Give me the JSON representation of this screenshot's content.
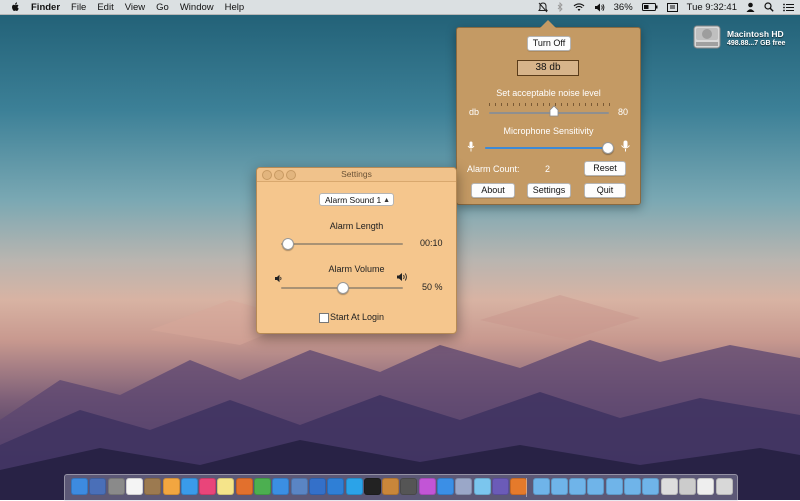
{
  "menubar": {
    "apple_icon": "apple-icon",
    "items": [
      "Finder",
      "File",
      "Edit",
      "View",
      "Go",
      "Window",
      "Help"
    ],
    "battery": "36%",
    "clock": "Tue 9:32:41"
  },
  "desktop": {
    "drive_name": "Macintosh HD",
    "drive_size": "498.88...7 GB free"
  },
  "popover": {
    "toggle_label": "Turn Off",
    "level_display": "38 db",
    "noise_label": "Set acceptable noise level",
    "noise_unit": "db",
    "noise_value": "80",
    "noise_fraction": 0.5,
    "mic_label": "Microphone Sensitivity",
    "mic_fraction": 1.0,
    "alarm_count_label": "Alarm Count:",
    "alarm_count": "2",
    "reset_label": "Reset",
    "about_label": "About",
    "settings_label": "Settings",
    "quit_label": "Quit"
  },
  "settings": {
    "title": "Settings",
    "alarm_sound": "Alarm Sound 1",
    "alarm_length_label": "Alarm Length",
    "alarm_length_value": "00:10",
    "alarm_length_fraction": 0.05,
    "alarm_volume_label": "Alarm Volume",
    "alarm_volume_value": "50 %",
    "alarm_volume_fraction": 0.5,
    "start_at_login_label": "Start At Login",
    "start_at_login": false
  },
  "colors": {
    "popover_bg": "#c49a64",
    "settings_bg": "#f5c68d",
    "slider_blue": "#3e8ad5"
  }
}
